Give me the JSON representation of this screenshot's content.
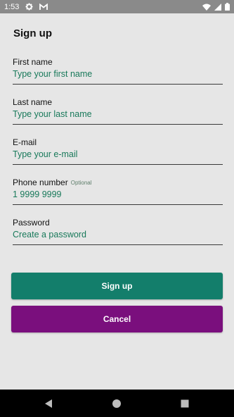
{
  "status_bar": {
    "time": "1:53",
    "icons": [
      "gear-icon",
      "gmail-icon",
      "wifi-icon",
      "signal-icon",
      "battery-icon"
    ]
  },
  "page": {
    "title": "Sign up"
  },
  "form": {
    "first_name": {
      "label": "First name",
      "placeholder": "Type your first name"
    },
    "last_name": {
      "label": "Last name",
      "placeholder": "Type your last name"
    },
    "email": {
      "label": "E-mail",
      "placeholder": "Type your e-mail"
    },
    "phone": {
      "label": "Phone number",
      "optional_tag": "Optional",
      "placeholder": "1 9999 9999"
    },
    "password": {
      "label": "Password",
      "placeholder": "Create a password"
    }
  },
  "buttons": {
    "signup_label": "Sign up",
    "cancel_label": "Cancel"
  },
  "colors": {
    "accent_green": "#137e6b",
    "cancel_purple": "#7a0f7d",
    "input_text": "#18795a",
    "background": "#e6e6e6"
  },
  "nav_bar": {
    "icons": [
      "back-icon",
      "home-icon",
      "recents-icon"
    ]
  }
}
